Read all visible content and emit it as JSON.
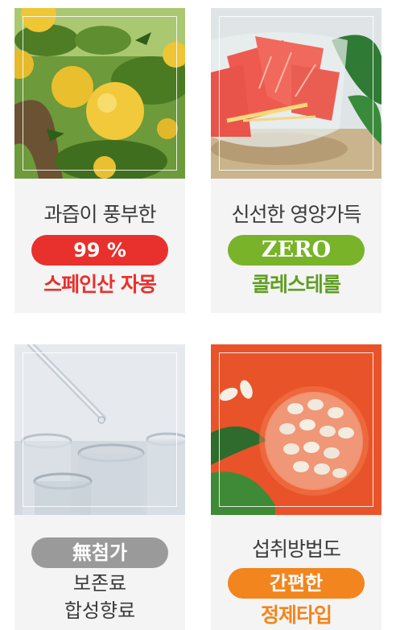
{
  "cards": [
    {
      "line1": "과즙이 풍부한",
      "pill": "99 %",
      "line3": "스페인산 자몽",
      "pill_color": "#e8302c",
      "line3_color": "#e8302c",
      "image": "grapefruit-tree"
    },
    {
      "line1": "신선한 영양가득",
      "pill": "ZERO",
      "line3": "콜레스테롤",
      "pill_color": "#79b32a",
      "line3_color": "#5f9e22",
      "image": "grapefruit-slices-bowl"
    },
    {
      "pill": "無첨가",
      "line2a": "보존료",
      "line2b": "합성향료",
      "pill_color": "#9a9a9a",
      "image": "glass-test-tubes"
    },
    {
      "line1": "섭취방법도",
      "pill": "간편한",
      "line3": "정제타입",
      "pill_color": "#f2851d",
      "line3_color": "#f2851d",
      "image": "white-tablets-bowl"
    }
  ]
}
